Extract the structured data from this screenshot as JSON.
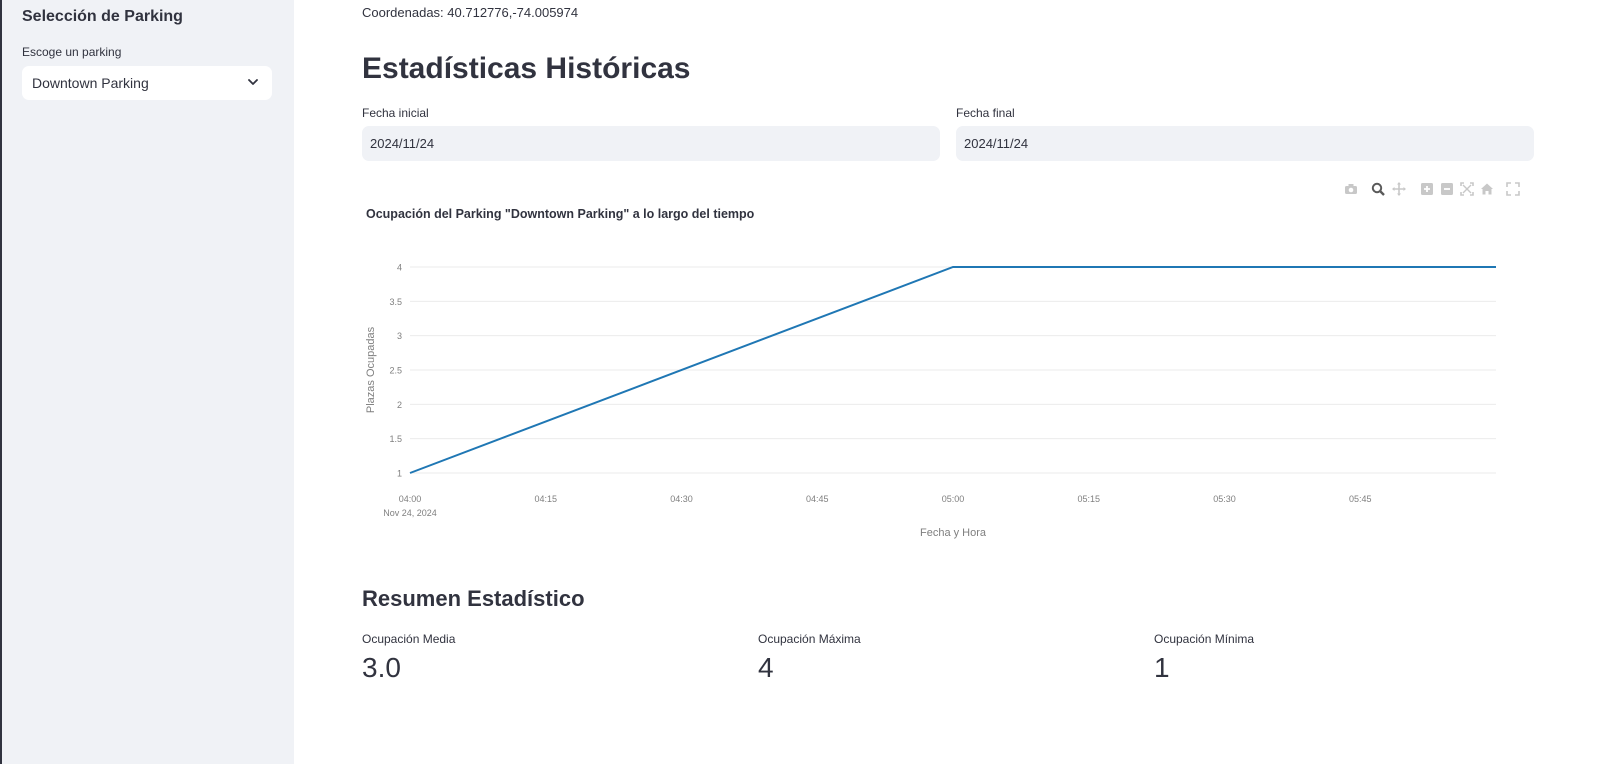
{
  "sidebar": {
    "title": "Selección de Parking",
    "select_label": "Escoge un parking",
    "selected_parking": "Downtown Parking"
  },
  "main": {
    "coordinates_text": "Coordenadas: 40.712776,-74.005974",
    "historical_title": "Estadísticas Históricas",
    "start_date": {
      "label": "Fecha inicial",
      "value": "2024/11/24"
    },
    "end_date": {
      "label": "Fecha final",
      "value": "2024/11/24"
    },
    "summary_title": "Resumen Estadístico",
    "metrics": [
      {
        "label": "Ocupación Media",
        "value": "3.0"
      },
      {
        "label": "Ocupación Máxima",
        "value": "4"
      },
      {
        "label": "Ocupación Mínima",
        "value": "1"
      }
    ]
  },
  "modebar_icons": [
    "camera-icon",
    "zoom-icon",
    "pan-icon",
    "zoom-in-icon",
    "zoom-out-icon",
    "autoscale-icon",
    "reset-axes-icon",
    "fullscreen-icon"
  ],
  "colors": {
    "line": "#1f77b4",
    "sidebar_bg": "#f0f2f6",
    "input_bg": "#f0f2f6",
    "text": "#31333f",
    "axis_text": "#7f7f7f",
    "grid": "#ebebeb"
  },
  "chart_data": {
    "type": "line",
    "title": "Ocupación del Parking \"Downtown Parking\" a lo largo del tiempo",
    "xlabel": "Fecha y Hora",
    "ylabel": "Plazas Ocupadas",
    "x_tick_labels": [
      "04:00",
      "04:15",
      "04:30",
      "04:45",
      "05:00",
      "05:15",
      "05:30",
      "05:45"
    ],
    "x_tick_sublabel": "Nov 24, 2024",
    "x_tick_minutes": [
      0,
      15,
      30,
      45,
      60,
      75,
      90,
      105
    ],
    "y_tick_labels": [
      "1",
      "1.5",
      "2",
      "2.5",
      "3",
      "3.5",
      "4"
    ],
    "y_tick_values": [
      1,
      1.5,
      2,
      2.5,
      3,
      3.5,
      4
    ],
    "ylim": [
      1,
      4
    ],
    "xlim_minutes": [
      0,
      120
    ],
    "grid": true,
    "series": [
      {
        "x_minutes": [
          0,
          60,
          120
        ],
        "x": [
          "04:00",
          "05:00",
          "06:00"
        ],
        "values": [
          1,
          4,
          4
        ]
      }
    ]
  }
}
